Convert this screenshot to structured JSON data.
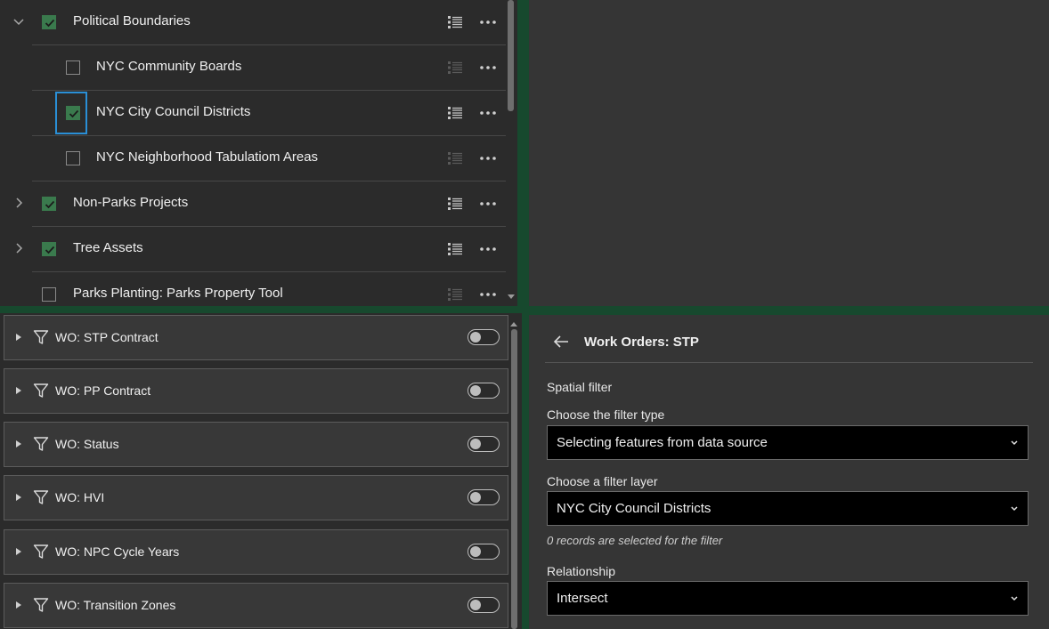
{
  "layers": {
    "items": [
      {
        "label": "Political Boundaries",
        "checked": true,
        "expander": "chevron-down",
        "indent": 0,
        "legend_active": true
      },
      {
        "label": "NYC Community Boards",
        "checked": false,
        "expander": "",
        "indent": 1,
        "legend_active": false
      },
      {
        "label": "NYC City Council Districts",
        "checked": true,
        "expander": "",
        "indent": 1,
        "legend_active": true,
        "focused": true
      },
      {
        "label": "NYC Neighborhood Tabulatiom Areas",
        "checked": false,
        "expander": "",
        "indent": 1,
        "legend_active": false
      },
      {
        "label": "Non-Parks Projects",
        "checked": true,
        "expander": "chevron-right",
        "indent": 0,
        "legend_active": true
      },
      {
        "label": "Tree Assets",
        "checked": true,
        "expander": "chevron-right",
        "indent": 0,
        "legend_active": true
      },
      {
        "label": "Parks Planting: Parks Property Tool",
        "checked": false,
        "expander": "",
        "indent": 0,
        "legend_active": false
      }
    ]
  },
  "filters": {
    "items": [
      {
        "label": "WO: STP Contract",
        "enabled": false
      },
      {
        "label": "WO: PP Contract",
        "enabled": false
      },
      {
        "label": "WO: Status",
        "enabled": false
      },
      {
        "label": "WO: HVI",
        "enabled": false
      },
      {
        "label": "WO: NPC Cycle Years",
        "enabled": false
      },
      {
        "label": "WO: Transition Zones",
        "enabled": false
      }
    ]
  },
  "detail": {
    "title": "Work Orders: STP",
    "spatial_filter_label": "Spatial filter",
    "filter_type_label": "Choose the filter type",
    "filter_type_value": "Selecting features from data source",
    "filter_layer_label": "Choose a filter layer",
    "filter_layer_value": "NYC City Council Districts",
    "records_note": "0 records are selected for the filter",
    "relationship_label": "Relationship",
    "relationship_value": "Intersect"
  },
  "colors": {
    "accent_green": "#3a7a4d",
    "background_green": "#17492e",
    "focus_blue": "#2a8fd6"
  }
}
